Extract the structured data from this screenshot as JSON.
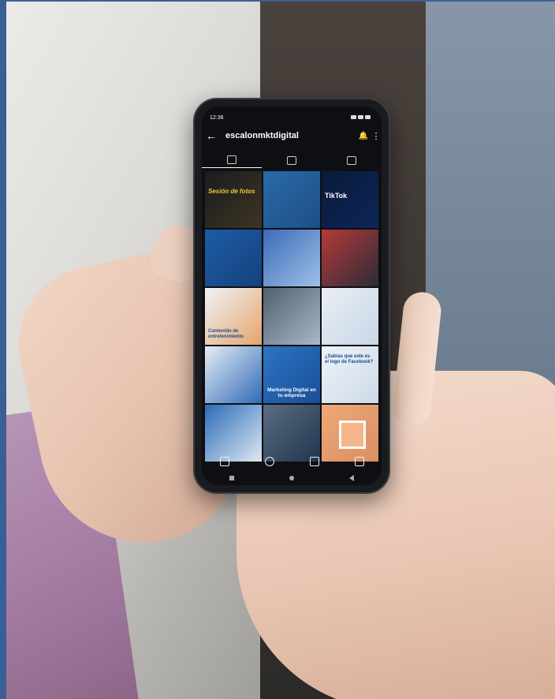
{
  "status": {
    "time": "12:36"
  },
  "profile": {
    "username": "escalonmktdigital"
  },
  "posts": [
    {
      "caption": "Sesión de fotos"
    },
    {
      "caption": ""
    },
    {
      "caption": "TikTok"
    },
    {
      "caption": ""
    },
    {
      "caption": ""
    },
    {
      "caption": ""
    },
    {
      "caption": "Contenido de entretenimiento"
    },
    {
      "caption": ""
    },
    {
      "caption": ""
    },
    {
      "caption": ""
    },
    {
      "caption": "Marketing Digital en tu empresa"
    },
    {
      "caption": "¿Sabías que este es el logo de Facebook?"
    },
    {
      "caption": ""
    },
    {
      "caption": ""
    },
    {
      "caption": ""
    }
  ],
  "icons": {
    "back": "arrow-left-icon",
    "bell": "bell-icon",
    "more": "more-icon",
    "grid_tab": "grid-icon",
    "reels_tab": "reels-icon",
    "tagged_tab": "tagged-icon",
    "home": "home-icon",
    "search": "search-icon",
    "create": "add-icon",
    "reels": "reels-icon"
  }
}
